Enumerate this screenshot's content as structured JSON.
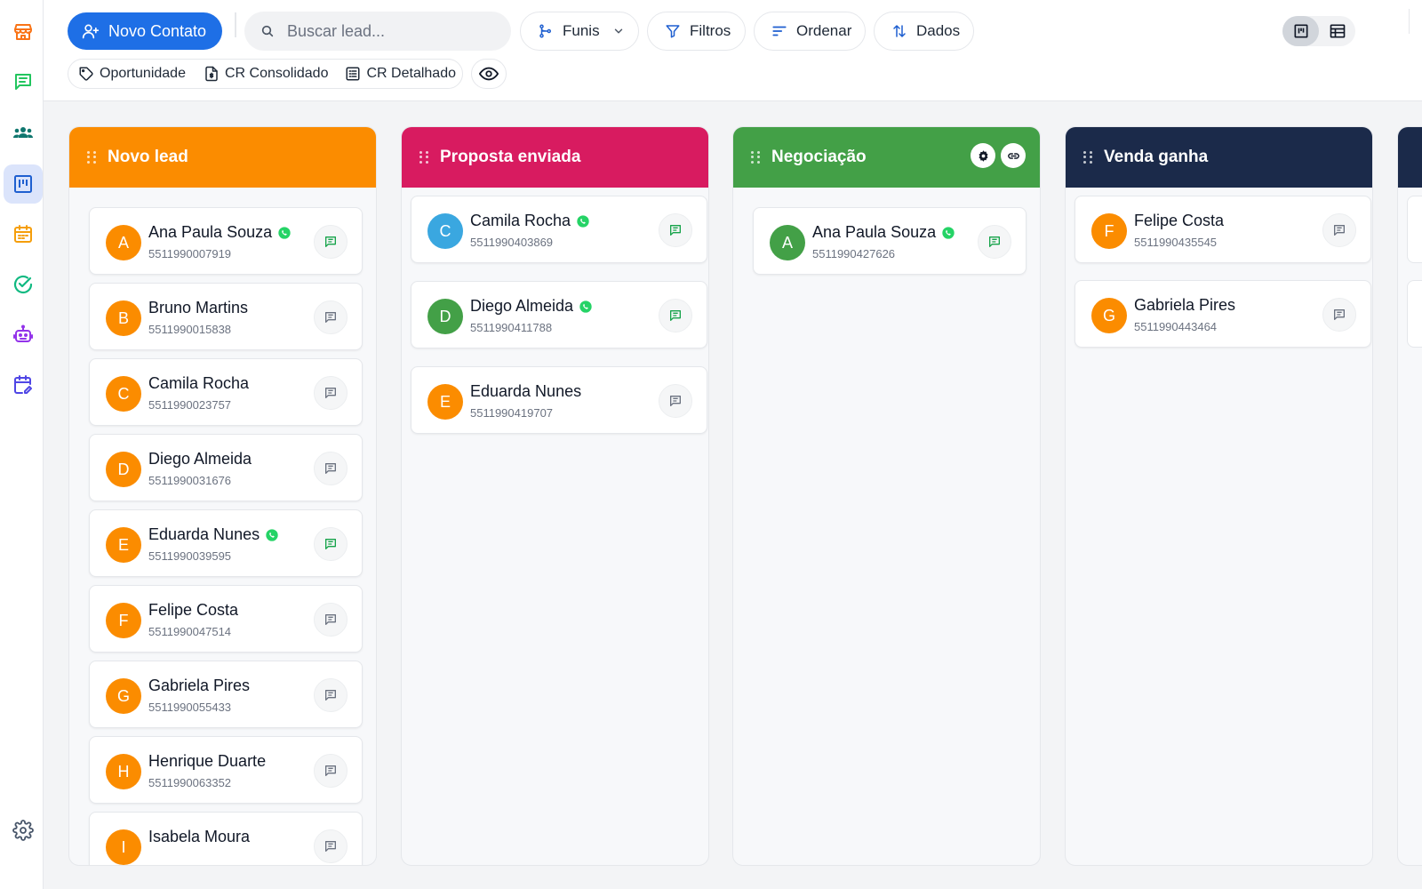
{
  "toolbar": {
    "new_contact_label": "Novo Contato",
    "search_placeholder": "Buscar lead...",
    "funis_label": "Funis",
    "filtros_label": "Filtros",
    "ordenar_label": "Ordenar",
    "dados_label": "Dados"
  },
  "chips": {
    "oportunidade": "Oportunidade",
    "cr_consolidado": "CR Consolidado",
    "cr_detalhado": "CR Detalhado"
  },
  "sidebar_icons": [
    "store-icon",
    "chat-icon",
    "contacts-icon",
    "kanban-icon",
    "calendar-icon",
    "tasks-icon",
    "robot-icon",
    "schedule-edit-icon",
    "settings-icon"
  ],
  "colors": {
    "primary": "#1e6fe6",
    "novo_lead": "#fb8c00",
    "proposta": "#d81b60",
    "negociacao": "#43a047",
    "venda": "#1b2a4a",
    "whatsapp": "#25d366",
    "avatar_orange": "#fb8c00",
    "avatar_blue": "#3aa7e0",
    "avatar_green": "#43a047"
  },
  "columns": [
    {
      "title": "Novo lead",
      "cards": [
        {
          "initial": "A",
          "name": "Ana Paula Souza",
          "phone": "5511990007919",
          "whatsapp": true,
          "message_active": true
        },
        {
          "initial": "B",
          "name": "Bruno Martins",
          "phone": "5511990015838",
          "whatsapp": false,
          "message_active": false
        },
        {
          "initial": "C",
          "name": "Camila Rocha",
          "phone": "5511990023757",
          "whatsapp": false,
          "message_active": false
        },
        {
          "initial": "D",
          "name": "Diego Almeida",
          "phone": "5511990031676",
          "whatsapp": false,
          "message_active": false
        },
        {
          "initial": "E",
          "name": "Eduarda Nunes",
          "phone": "5511990039595",
          "whatsapp": true,
          "message_active": true
        },
        {
          "initial": "F",
          "name": "Felipe Costa",
          "phone": "5511990047514",
          "whatsapp": false,
          "message_active": false
        },
        {
          "initial": "G",
          "name": "Gabriela Pires",
          "phone": "5511990055433",
          "whatsapp": false,
          "message_active": false
        },
        {
          "initial": "H",
          "name": "Henrique Duarte",
          "phone": "5511990063352",
          "whatsapp": false,
          "message_active": false
        },
        {
          "initial": "I",
          "name": "Isabela Moura",
          "phone": "",
          "whatsapp": false,
          "message_active": false
        }
      ]
    },
    {
      "title": "Proposta enviada",
      "cards": [
        {
          "initial": "C",
          "name": "Camila Rocha",
          "phone": "5511990403869",
          "whatsapp": true,
          "message_active": true
        },
        {
          "initial": "D",
          "name": "Diego Almeida",
          "phone": "5511990411788",
          "whatsapp": true,
          "message_active": true
        },
        {
          "initial": "E",
          "name": "Eduarda Nunes",
          "phone": "5511990419707",
          "whatsapp": false,
          "message_active": false
        }
      ]
    },
    {
      "title": "Negociação",
      "cards": [
        {
          "initial": "A",
          "name": "Ana Paula Souza",
          "phone": "5511990427626",
          "whatsapp": true,
          "message_active": true
        }
      ]
    },
    {
      "title": "Venda ganha",
      "cards": [
        {
          "initial": "F",
          "name": "Felipe Costa",
          "phone": "5511990435545",
          "whatsapp": false,
          "message_active": false
        },
        {
          "initial": "G",
          "name": "Gabriela Pires",
          "phone": "5511990443464",
          "whatsapp": false,
          "message_active": false
        }
      ]
    }
  ]
}
